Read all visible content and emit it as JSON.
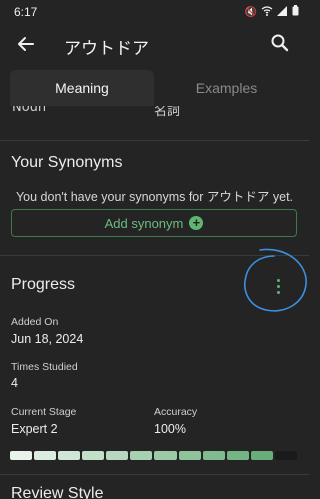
{
  "status_bar": {
    "time": "6:17"
  },
  "app_bar": {
    "title": "アウトドア"
  },
  "tabs": [
    {
      "label": "Meaning",
      "active": true
    },
    {
      "label": "Examples",
      "active": false
    }
  ],
  "meaning_row": {
    "part_of_speech": "Noun",
    "japanese": "名詞"
  },
  "synonyms": {
    "title": "Your Synonyms",
    "empty_text": "You don't have your synonyms for アウトドア yet.",
    "add_label": "Add synonym"
  },
  "progress": {
    "title": "Progress",
    "added_on_label": "Added On",
    "added_on_value": "Jun 18, 2024",
    "times_studied_label": "Times Studied",
    "times_studied_value": "4",
    "current_stage_label": "Current Stage",
    "current_stage_value": "Expert 2",
    "accuracy_label": "Accuracy",
    "accuracy_value": "100%",
    "stage_segments_filled": 11,
    "stage_segments_total": 12
  },
  "review": {
    "title": "Review Style"
  },
  "colors": {
    "accent": "#5fb572",
    "background": "#242424",
    "annotation": "#3d8fe0"
  }
}
